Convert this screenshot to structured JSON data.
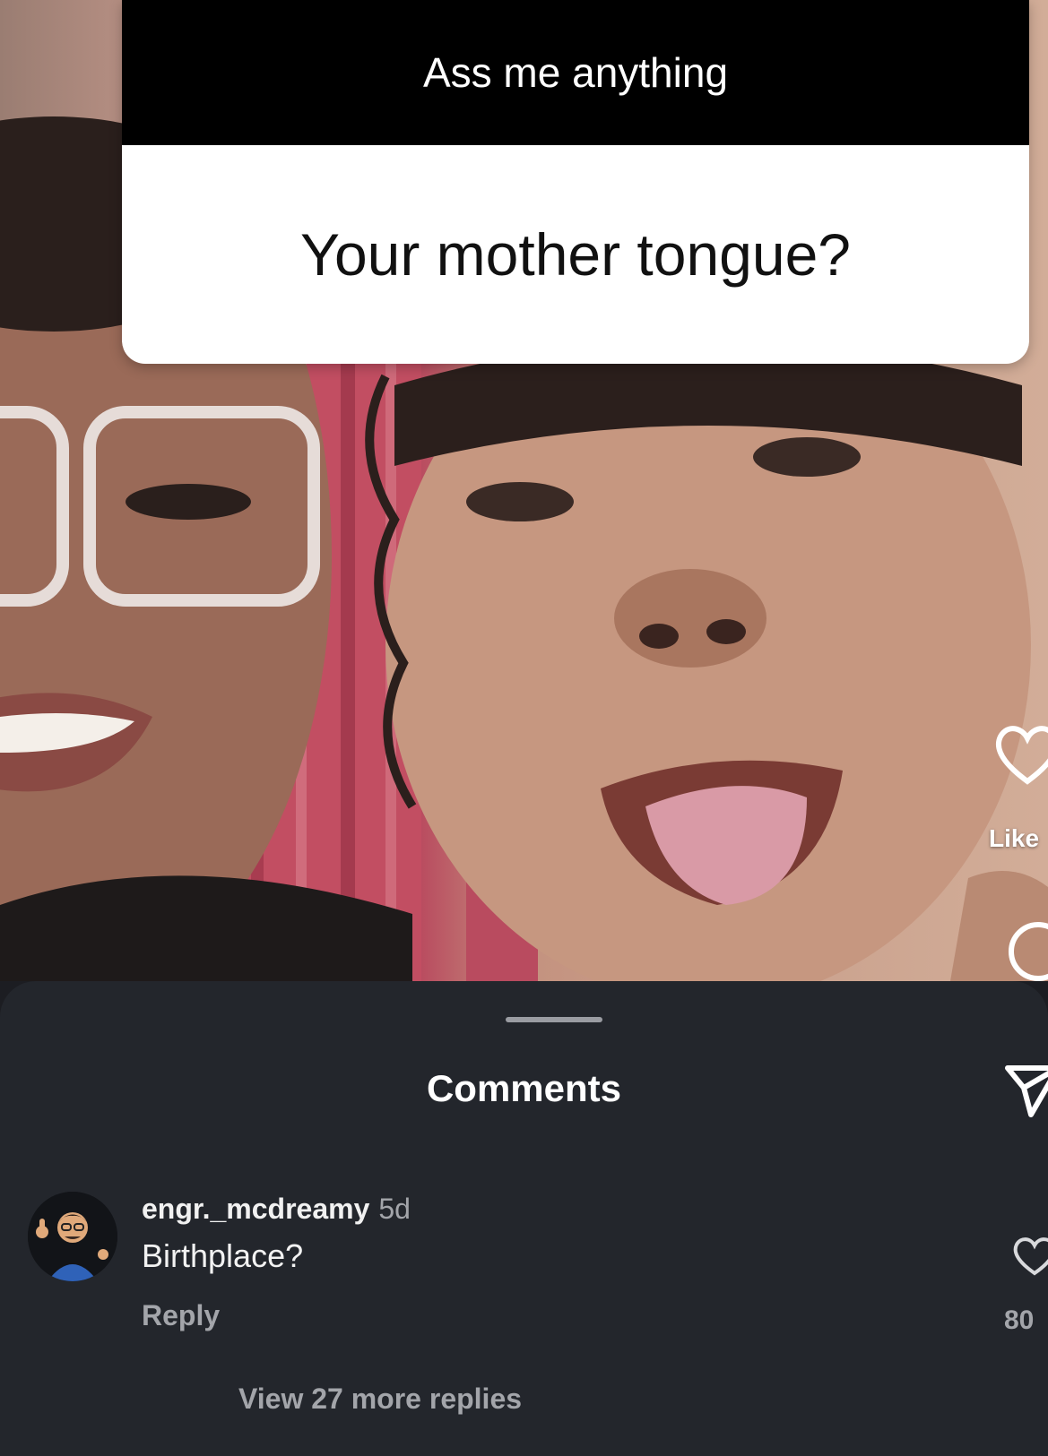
{
  "story": {
    "question_prompt": "Ass me anything",
    "question_text": "Your mother tongue?"
  },
  "actions": {
    "like_label": "Like",
    "like_icon": "heart-outline-icon",
    "comment_icon": "comment-bubble-icon",
    "share_icon": "paper-plane-icon"
  },
  "comments_sheet": {
    "title": "Comments",
    "comments": [
      {
        "username": "engr._mcdreamy",
        "time": "5d",
        "text": "Birthplace?",
        "reply_label": "Reply",
        "like_count": "80",
        "view_replies_label": "View 27 more replies"
      }
    ]
  },
  "colors": {
    "sheet_background": "#23262c",
    "sticker_header": "#000000",
    "sticker_body": "#ffffff",
    "muted_text": "#a3a5aa"
  }
}
